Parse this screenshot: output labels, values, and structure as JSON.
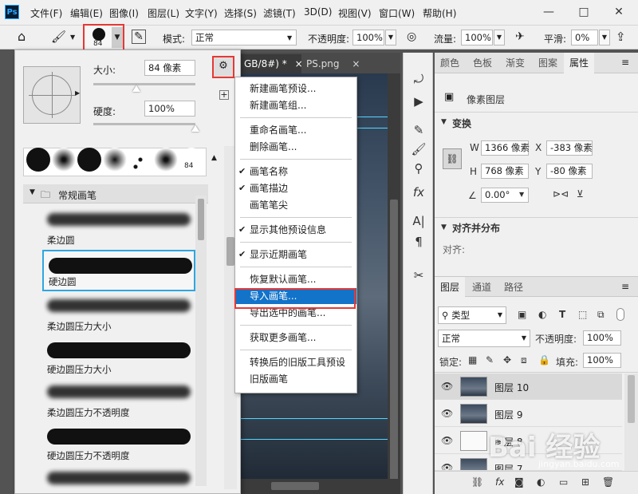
{
  "app": {
    "logo": "Ps"
  },
  "menubar": {
    "items": [
      "文件(F)",
      "编辑(E)",
      "图像(I)",
      "图层(L)",
      "文字(Y)",
      "选择(S)",
      "滤镜(T)",
      "3D(D)",
      "视图(V)",
      "窗口(W)",
      "帮助(H)"
    ],
    "window_controls": [
      "—",
      "□",
      "✕"
    ]
  },
  "optionsbar": {
    "brush_size_badge": "84",
    "mode_label": "模式:",
    "mode_value": "正常",
    "opacity_label": "不透明度:",
    "opacity_value": "100%",
    "flow_label": "流量:",
    "flow_value": "100%",
    "smooth_label": "平滑:",
    "smooth_value": "0%"
  },
  "brush_panel": {
    "size_label": "大小:",
    "size_value": "84 像素",
    "hardness_label": "硬度:",
    "hardness_value": "100%",
    "size_slider_fraction": 0.42,
    "hardness_slider_fraction": 1.0,
    "preset_badge": "84",
    "group_name": "常规画笔",
    "brushes": [
      {
        "name": "柔边圆",
        "soft": true
      },
      {
        "name": "硬边圆",
        "soft": false,
        "selected": true
      },
      {
        "name": "柔边圆压力大小",
        "soft": true
      },
      {
        "name": "硬边圆压力大小",
        "soft": false
      },
      {
        "name": "柔边圆压力不透明度",
        "soft": true
      },
      {
        "name": "硬边圆压力不透明度",
        "soft": false
      },
      {
        "name": "",
        "soft": true
      }
    ]
  },
  "context_menu": {
    "items": [
      {
        "label": "新建画笔预设...",
        "checked": false
      },
      {
        "label": "新建画笔组...",
        "checked": false
      },
      {
        "label": "重命名画笔...",
        "checked": false
      },
      {
        "label": "删除画笔...",
        "checked": false
      },
      {
        "label": "画笔名称",
        "checked": true
      },
      {
        "label": "画笔描边",
        "checked": true
      },
      {
        "label": "画笔笔尖",
        "checked": false
      },
      {
        "label": "显示其他预设信息",
        "checked": true
      },
      {
        "label": "显示近期画笔",
        "checked": true
      },
      {
        "label": "恢复默认画笔...",
        "checked": false
      },
      {
        "label": "导入画笔...",
        "checked": false,
        "highlighted": true
      },
      {
        "label": "导出选中的画笔...",
        "checked": false
      },
      {
        "label": "获取更多画笔...",
        "checked": false
      },
      {
        "label": "转换后的旧版工具预设",
        "checked": false
      },
      {
        "label": "旧版画笔",
        "checked": false
      }
    ]
  },
  "document": {
    "tabs": [
      {
        "label": "GB/8#) *"
      },
      {
        "label": "PS.png"
      }
    ],
    "close_glyph": "×"
  },
  "properties_panel": {
    "tabs": [
      "颜色",
      "色板",
      "渐变",
      "图案",
      "属性"
    ],
    "active_tab": "属性",
    "layer_type": "像素图层",
    "transform_title": "变换",
    "w_label": "W",
    "w_value": "1366 像素",
    "x_label": "X",
    "x_value": "-383 像素",
    "h_label": "H",
    "h_value": "768 像素",
    "y_label": "Y",
    "y_value": "-80 像素",
    "angle_value": "0.00°",
    "align_title": "对齐并分布",
    "align_label": "对齐:"
  },
  "layers_panel": {
    "tabs": [
      "图层",
      "通道",
      "路径"
    ],
    "filter_value": "类型",
    "blend_value": "正常",
    "opacity_label": "不透明度:",
    "opacity_value": "100%",
    "lock_label": "锁定:",
    "fill_label": "填充:",
    "fill_value": "100%",
    "layers": [
      {
        "name": "图层 10",
        "selected": true
      },
      {
        "name": "图层 9",
        "selected": false
      },
      {
        "name": "图层 8",
        "selected": false
      },
      {
        "name": "图层 7",
        "selected": false
      }
    ]
  },
  "watermark": {
    "text": "Bai 经验",
    "sub": "jingyan.baidu.com"
  }
}
